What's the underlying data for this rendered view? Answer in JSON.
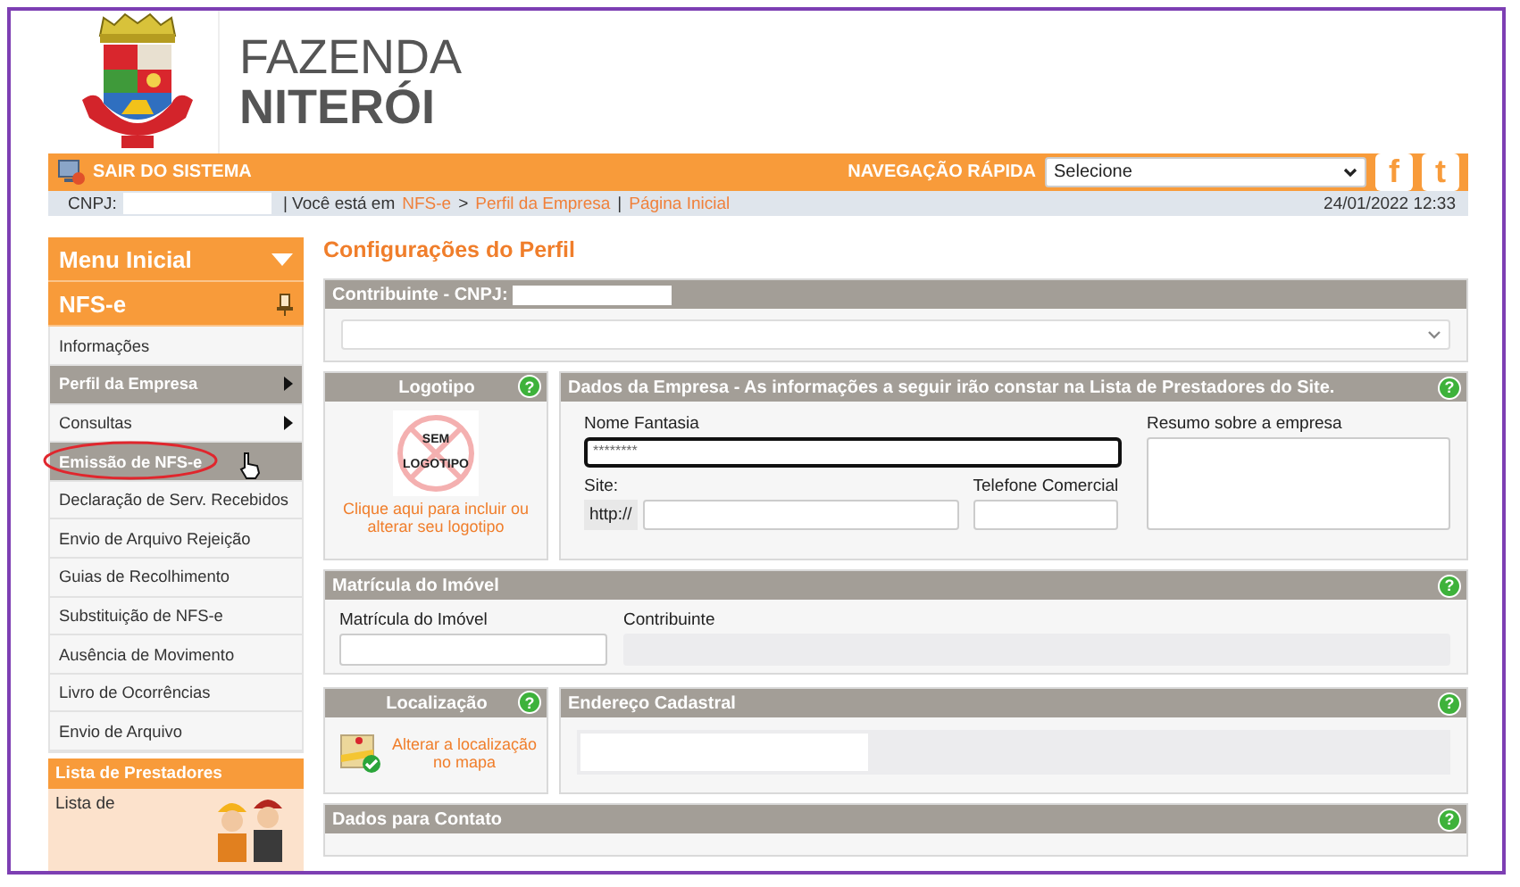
{
  "header": {
    "title_line1": "FAZENDA",
    "title_line2": "NITERÓI"
  },
  "top_bar": {
    "logout": "SAIR DO SISTEMA",
    "quick_nav_label": "NAVEGAÇÃO RÁPIDA",
    "quick_nav": {
      "value": "Selecione"
    },
    "social": [
      "f",
      "t"
    ]
  },
  "breadcrumb_bar": {
    "cnpj_label": "CNPJ:",
    "you_are_in": "| Você está em",
    "trail": [
      {
        "kind": "link",
        "text": "NFS-e"
      },
      {
        "kind": "separator",
        "text": ">"
      },
      {
        "kind": "link",
        "text": "Perfil da Empresa"
      },
      {
        "kind": "separator",
        "text": "|"
      },
      {
        "kind": "link",
        "text": "Página Inicial"
      }
    ],
    "datetime": "24/01/2022 12:33"
  },
  "sidebar": {
    "menu_title": "Menu Inicial",
    "section": "NFS-e",
    "items": [
      {
        "label": "Informações",
        "highlighted": false,
        "has_submenu": false,
        "circled": false,
        "cursor": false
      },
      {
        "label": "Perfil da Empresa",
        "highlighted": true,
        "has_submenu": true,
        "circled": false,
        "cursor": false
      },
      {
        "label": "Consultas",
        "highlighted": false,
        "has_submenu": true,
        "circled": false,
        "cursor": false
      },
      {
        "label": "Emissão de NFS-e",
        "highlighted": true,
        "has_submenu": false,
        "circled": true,
        "cursor": true
      },
      {
        "label": "Declaração de Serv. Recebidos",
        "highlighted": false,
        "has_submenu": false,
        "circled": false,
        "cursor": false
      },
      {
        "label": "Envio de Arquivo Rejeição",
        "highlighted": false,
        "has_submenu": false,
        "circled": false,
        "cursor": false
      },
      {
        "label": "Guias de Recolhimento",
        "highlighted": false,
        "has_submenu": false,
        "circled": false,
        "cursor": false
      },
      {
        "label": "Substituição de NFS-e",
        "highlighted": false,
        "has_submenu": false,
        "circled": false,
        "cursor": false
      },
      {
        "label": "Ausência de Movimento",
        "highlighted": false,
        "has_submenu": false,
        "circled": false,
        "cursor": false
      },
      {
        "label": "Livro de Ocorrências",
        "highlighted": false,
        "has_submenu": false,
        "circled": false,
        "cursor": false
      },
      {
        "label": "Envio de Arquivo",
        "highlighted": false,
        "has_submenu": false,
        "circled": false,
        "cursor": false
      }
    ],
    "promo": {
      "title": "Lista de Prestadores",
      "text": "Lista de"
    }
  },
  "main": {
    "title": "Configurações do Perfil",
    "contribuinte": {
      "title": "Contribuinte - CNPJ:"
    },
    "logotipo": {
      "title": "Logotipo",
      "help": "?",
      "placeholder_line1": "SEM",
      "placeholder_line2": "LOGOTIPO",
      "link": "Clique aqui para incluir ou alterar seu logotipo"
    },
    "dados_empresa": {
      "title": "Dados da Empresa - As informações a seguir irão constar na Lista de Prestadores do Site.",
      "help": "?",
      "nome_fantasia": {
        "label": "Nome Fantasia",
        "value": "********",
        "focused": true
      },
      "site": {
        "label": "Site:",
        "prefix": "http://"
      },
      "telefone": {
        "label": "Telefone Comercial"
      },
      "resumo": {
        "label": "Resumo sobre a empresa"
      }
    },
    "matricula": {
      "title": "Matrícula do Imóvel",
      "help": "?",
      "fields": [
        {
          "label": "Matrícula do Imóvel",
          "disabled": false
        },
        {
          "label": "Contribuinte",
          "disabled": true
        }
      ]
    },
    "localizacao": {
      "title": "Localização",
      "help": "?",
      "link": "Alterar a localização no mapa"
    },
    "endereco": {
      "title": "Endereço Cadastral",
      "help": "?"
    },
    "contato": {
      "title": "Dados para Contato",
      "help": "?"
    }
  }
}
